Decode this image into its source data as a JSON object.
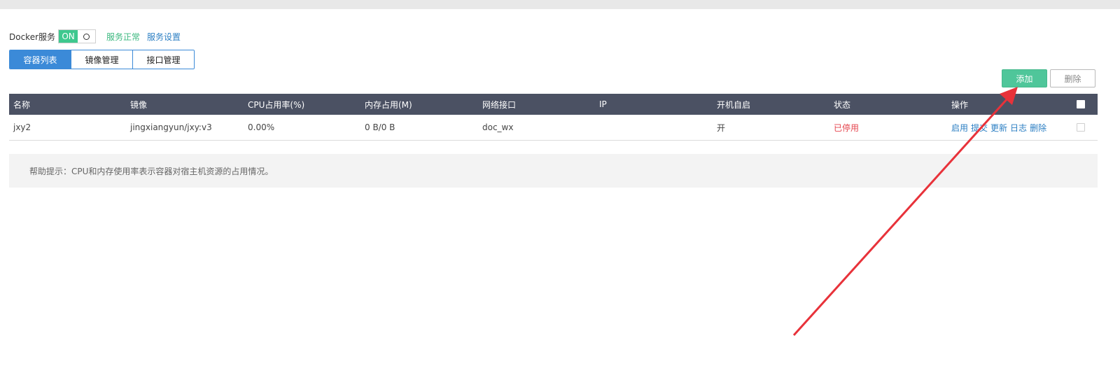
{
  "service": {
    "label": "Docker服务",
    "toggle_on": "ON",
    "status": "服务正常",
    "settings_link": "服务设置"
  },
  "tabs": [
    {
      "label": "容器列表",
      "active": true
    },
    {
      "label": "镜像管理",
      "active": false
    },
    {
      "label": "接口管理",
      "active": false
    }
  ],
  "toolbar": {
    "add_label": "添加",
    "delete_label": "删除"
  },
  "table": {
    "columns": [
      "名称",
      "镜像",
      "CPU占用率(%)",
      "内存占用(M)",
      "网络接口",
      "IP",
      "开机自启",
      "状态",
      "操作"
    ],
    "rows": [
      {
        "name": "jxy2",
        "image": "jingxiangyun/jxy:v3",
        "cpu": "0.00%",
        "memory": "0 B/0 B",
        "network": "doc_wx",
        "ip": "",
        "autostart": "开",
        "status": "已停用",
        "actions": [
          "启用",
          "提交",
          "更新",
          "日志",
          "删除"
        ]
      }
    ]
  },
  "help_text": "帮助提示：CPU和内存使用率表示容器对宿主机资源的占用情况。",
  "colors": {
    "accent_blue": "#3b8ad8",
    "header_bg": "#4b5163",
    "add_green": "#4fc69a",
    "status_red": "#e5454e",
    "annotation_arrow": "#e8323a"
  }
}
